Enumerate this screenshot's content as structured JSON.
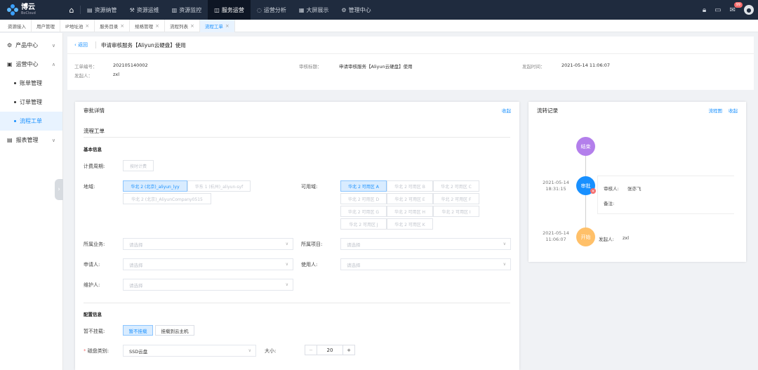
{
  "logo": {
    "name": "博云",
    "sub": "BoCloud"
  },
  "nav": [
    {
      "label": "资源纳管",
      "icon": "storage-icon"
    },
    {
      "label": "资源运维",
      "icon": "wrench-icon"
    },
    {
      "label": "资源监控",
      "icon": "chart-icon"
    },
    {
      "label": "服务运营",
      "icon": "service-icon",
      "active": true
    },
    {
      "label": "运营分析",
      "icon": "analysis-icon"
    },
    {
      "label": "大屏展示",
      "icon": "screen-icon"
    },
    {
      "label": "管理中心",
      "icon": "gear-icon"
    }
  ],
  "notifications": {
    "count": "99"
  },
  "tabs": [
    {
      "label": "资源接入",
      "closable": false
    },
    {
      "label": "用户管理",
      "closable": false
    },
    {
      "label": "IP地址池",
      "closable": true
    },
    {
      "label": "服务目录",
      "closable": true
    },
    {
      "label": "规格管理",
      "closable": true
    },
    {
      "label": "流程列表",
      "closable": true
    },
    {
      "label": "流程工单",
      "closable": true,
      "active": true
    }
  ],
  "sidebar": {
    "items": [
      {
        "label": "产品中心",
        "icon": "product-icon",
        "arrow": "∨"
      },
      {
        "label": "运营中心",
        "icon": "operation-icon",
        "arrow": "∧"
      },
      {
        "label": "账单管理",
        "sub": true
      },
      {
        "label": "订单管理",
        "sub": true
      },
      {
        "label": "流程工单",
        "sub": true,
        "selected": true
      },
      {
        "label": "报表管理",
        "icon": "report-icon",
        "arrow": "∨"
      }
    ]
  },
  "header": {
    "back": "返回",
    "title": "申请审核服务【Aliyun云硬盘】使用",
    "order_no_label": "工单编号：",
    "order_no": "202105140002",
    "initiator_label": "发起人：",
    "initiator": "zxl",
    "review_title_label": "审核标题：",
    "review_title": "申请审核服务【Aliyun云硬盘】使用",
    "time_label": "发起时间：",
    "time": "2021-05-14 11:06:07"
  },
  "approval": {
    "title": "审批详情",
    "collapse": "收起",
    "flow_title": "流程工单",
    "basic_info": "基本信息",
    "billing_label": "计费周期:",
    "billing_value": "按时计费",
    "region_label": "地域:",
    "regions": [
      "华北 2 (北京)_aliyun_lyy",
      "华东 1 (杭州)_aliyun-syf",
      "华北 2 (北京)_AliyunCompany0515"
    ],
    "zone_label": "可用域:",
    "zones": [
      "华北 2 可用区 A",
      "华北 2 可用区 B",
      "华北 2 可用区 C",
      "华北 2 可用区 D",
      "华北 2 可用区 E",
      "华北 2 可用区 F",
      "华北 2 可用区 G",
      "华北 2 可用区 H",
      "华北 2 可用区 I",
      "华北 2 可用区 J",
      "华北 2 可用区 K"
    ],
    "business_label": "所属业务:",
    "project_label": "所属项目:",
    "applicant_label": "申请人:",
    "user_label": "使用人:",
    "maintainer_label": "维护人:",
    "placeholder": "请选择",
    "config_info": "配置信息",
    "mount_label": "暂不挂载:",
    "mount_opt1": "暂不挂载",
    "mount_opt2": "挂载到云主机",
    "disk_type_label": "磁盘类别:",
    "disk_type_value": "SSD云盘",
    "size_label": "大小:",
    "size_value": "20",
    "minus": "−",
    "plus": "+"
  },
  "flow": {
    "title": "流转记录",
    "chart": "流程图",
    "collapse": "收起",
    "end": "结束",
    "approve": "审批",
    "start": "开始",
    "approve_date": "2021-05-14",
    "approve_time": "18:31:15",
    "start_date": "2021-05-14",
    "start_time": "11:06:07",
    "reviewer_label": "审核人:",
    "reviewer": "张亦飞",
    "remark_label": "备注:",
    "initiator_label": "发起人:",
    "initiator": "zxl"
  },
  "colors": {
    "topbar": "#1f2b3e",
    "accent": "#1890ff",
    "end": "#b37feb",
    "approve": "#1890ff",
    "start": "#ffc069"
  }
}
